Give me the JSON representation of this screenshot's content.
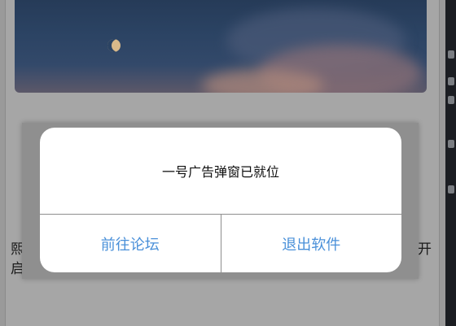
{
  "background": {
    "left_text_line1": "熙",
    "left_text_line2": "启",
    "right_text": "开"
  },
  "dialog": {
    "message": "一号广告弹窗已就位",
    "buttons": [
      {
        "label": "前往论坛"
      },
      {
        "label": "退出软件"
      }
    ]
  },
  "colors": {
    "accent": "#4a90d9",
    "overlay": "#9a9a9a",
    "dialog_bg": "#ffffff"
  }
}
